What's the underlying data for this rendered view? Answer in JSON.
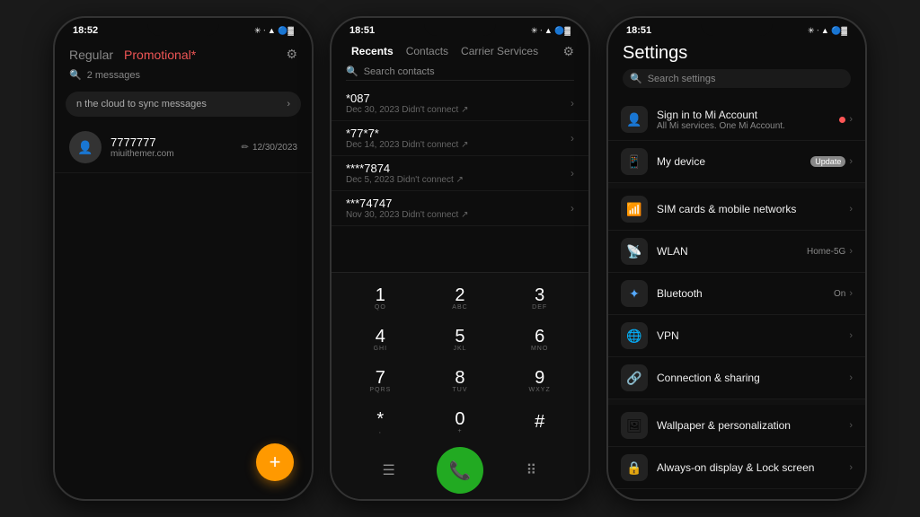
{
  "phone1": {
    "status": {
      "time": "18:52",
      "icons": "⊛ ᐧ ▲ 🔵▓"
    },
    "tabs": [
      {
        "label": "Regular",
        "active": false
      },
      {
        "label": "Promotional",
        "active": false,
        "highlight": true
      }
    ],
    "search_label": "2 messages",
    "sync_text": "n the cloud to sync messages",
    "messages": [
      {
        "name": "7777777",
        "sub": "miuithemer.com",
        "date": "12/30/2023",
        "pencil": true
      }
    ],
    "fab_label": "+"
  },
  "phone2": {
    "status": {
      "time": "18:51"
    },
    "tabs": [
      {
        "label": "Recents",
        "active": true
      },
      {
        "label": "Contacts",
        "active": false
      },
      {
        "label": "Carrier Services",
        "active": false
      }
    ],
    "search_placeholder": "Search contacts",
    "recents": [
      {
        "num": "*087",
        "date": "Dec 30, 2023 Didn't connect ↗"
      },
      {
        "num": "*77*7*",
        "date": "Dec 14, 2023 Didn't connect ↗"
      },
      {
        "num": "****7874",
        "date": "Dec 5, 2023 Didn't connect ↗"
      },
      {
        "num": "***74747",
        "date": "Nov 30, 2023 Didn't connect ↗"
      }
    ],
    "keypad": [
      [
        {
          "num": "1",
          "letters": "QO"
        },
        {
          "num": "2",
          "letters": "ABC"
        },
        {
          "num": "3",
          "letters": "DEF"
        }
      ],
      [
        {
          "num": "4",
          "letters": "GHI"
        },
        {
          "num": "5",
          "letters": "JKL"
        },
        {
          "num": "6",
          "letters": "MNO"
        }
      ],
      [
        {
          "num": "7",
          "letters": "PQRS"
        },
        {
          "num": "8",
          "letters": "TUV"
        },
        {
          "num": "9",
          "letters": "WXYZ"
        }
      ],
      [
        {
          "num": "*",
          "letters": ","
        },
        {
          "num": "0",
          "letters": "+"
        },
        {
          "num": "#",
          "letters": ""
        }
      ]
    ]
  },
  "phone3": {
    "status": {
      "time": "18:51"
    },
    "title": "Settings",
    "search_placeholder": "Search settings",
    "items": [
      {
        "icon": "👤",
        "name": "Sign in to Mi Account",
        "sub": "All Mi services. One Mi Account.",
        "dot": true,
        "value": "",
        "arrow": true
      },
      {
        "icon": "📱",
        "name": "My device",
        "sub": "",
        "badge": "Update",
        "value": "",
        "arrow": true
      },
      {
        "divider": true
      },
      {
        "icon": "📶",
        "name": "SIM cards & mobile networks",
        "sub": "",
        "value": "",
        "arrow": true
      },
      {
        "icon": "📡",
        "name": "WLAN",
        "sub": "",
        "value": "Home-5G",
        "arrow": true
      },
      {
        "icon": "🔷",
        "name": "Bluetooth",
        "sub": "",
        "value": "On",
        "arrow": true
      },
      {
        "icon": "🌐",
        "name": "VPN",
        "sub": "",
        "value": "",
        "arrow": true
      },
      {
        "icon": "🔗",
        "name": "Connection & sharing",
        "sub": "",
        "value": "",
        "arrow": true
      },
      {
        "divider": true
      },
      {
        "icon": "🖼",
        "name": "Wallpaper & personalization",
        "sub": "",
        "value": "",
        "arrow": true
      },
      {
        "icon": "🔒",
        "name": "Always-on display & Lock screen",
        "sub": "",
        "value": "",
        "arrow": true
      }
    ]
  }
}
